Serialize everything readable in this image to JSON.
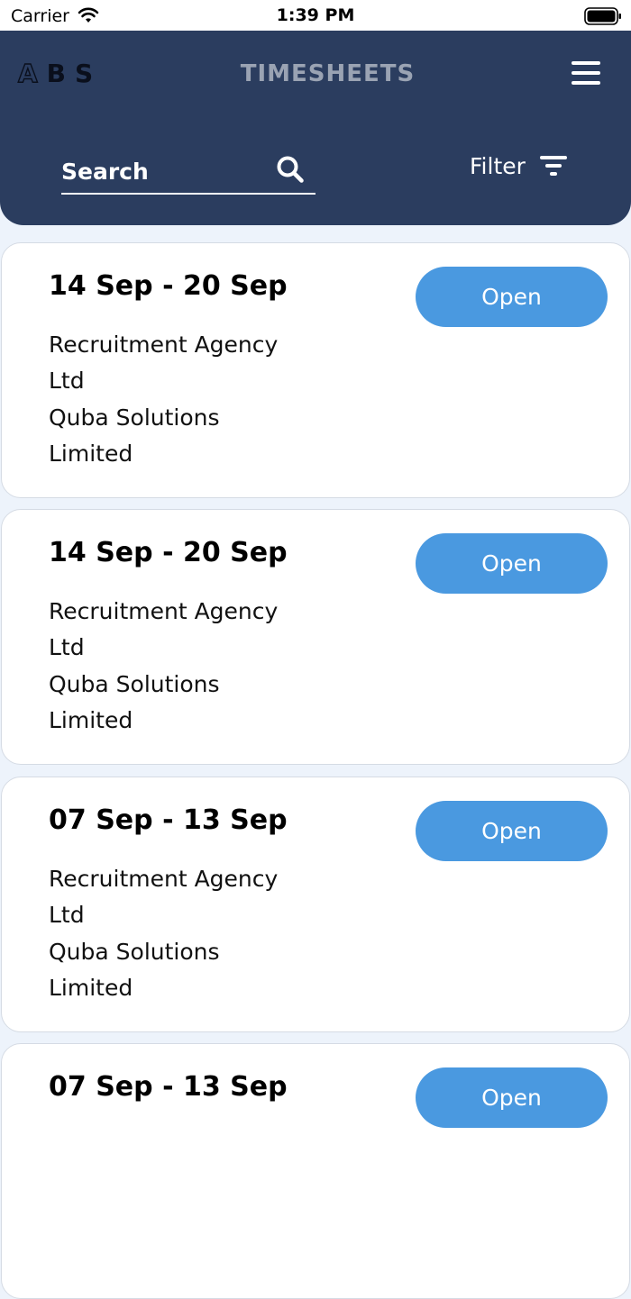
{
  "status_bar": {
    "carrier": "Carrier",
    "time": "1:39 PM"
  },
  "header": {
    "logo": {
      "letter_a": "A",
      "rest": "BS"
    },
    "title": "TIMESHEETS",
    "search": {
      "placeholder": "Search",
      "value": ""
    },
    "filter_label": "Filter"
  },
  "colors": {
    "header_bg": "#2b3d5f",
    "accent": "#4a99e0",
    "page_bg": "#edf3fb"
  },
  "timesheets": [
    {
      "date_range": "14 Sep - 20 Sep",
      "agency_line1": "Recruitment Agency",
      "agency_line2": "Ltd",
      "client_line1": "Quba Solutions",
      "client_line2": "Limited",
      "button_label": "Open"
    },
    {
      "date_range": "14 Sep - 20 Sep",
      "agency_line1": "Recruitment Agency",
      "agency_line2": "Ltd",
      "client_line1": "Quba Solutions",
      "client_line2": "Limited",
      "button_label": "Open"
    },
    {
      "date_range": "07 Sep - 13 Sep",
      "agency_line1": "Recruitment Agency",
      "agency_line2": "Ltd",
      "client_line1": "Quba Solutions",
      "client_line2": "Limited",
      "button_label": "Open"
    },
    {
      "date_range": "07 Sep - 13 Sep",
      "agency_line1": "",
      "agency_line2": "",
      "client_line1": "",
      "client_line2": "",
      "button_label": "Open"
    }
  ]
}
